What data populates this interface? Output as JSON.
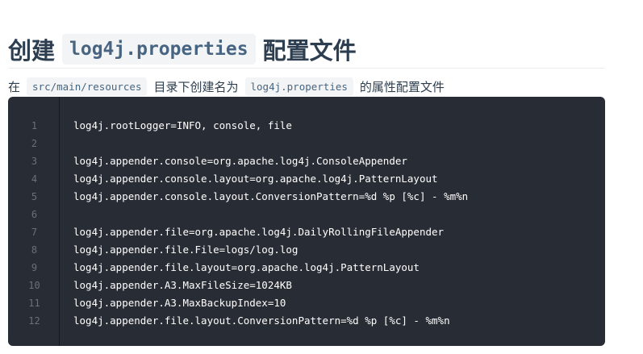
{
  "heading": {
    "prefix": "创建",
    "code": "log4j.properties",
    "suffix": "配置文件"
  },
  "intro": {
    "part1": "在",
    "code1": "src/main/resources",
    "part2": "目录下创建名为",
    "code2": "log4j.properties",
    "part3": "的属性配置文件"
  },
  "code_block": {
    "line_numbers": [
      "1",
      "2",
      "3",
      "4",
      "5",
      "6",
      "7",
      "8",
      "9",
      "10",
      "11",
      "12"
    ],
    "lines": [
      "log4j.rootLogger=INFO, console, file",
      "",
      "log4j.appender.console=org.apache.log4j.ConsoleAppender",
      "log4j.appender.console.layout=org.apache.log4j.PatternLayout",
      "log4j.appender.console.layout.ConversionPattern=%d %p [%c] - %m%n",
      "",
      "log4j.appender.file=org.apache.log4j.DailyRollingFileAppender",
      "log4j.appender.file.File=logs/log.log",
      "log4j.appender.file.layout=org.apache.log4j.PatternLayout",
      "log4j.appender.A3.MaxFileSize=1024KB",
      "log4j.appender.A3.MaxBackupIndex=10",
      "log4j.appender.file.layout.ConversionPattern=%d %p [%c] - %m%n"
    ]
  }
}
